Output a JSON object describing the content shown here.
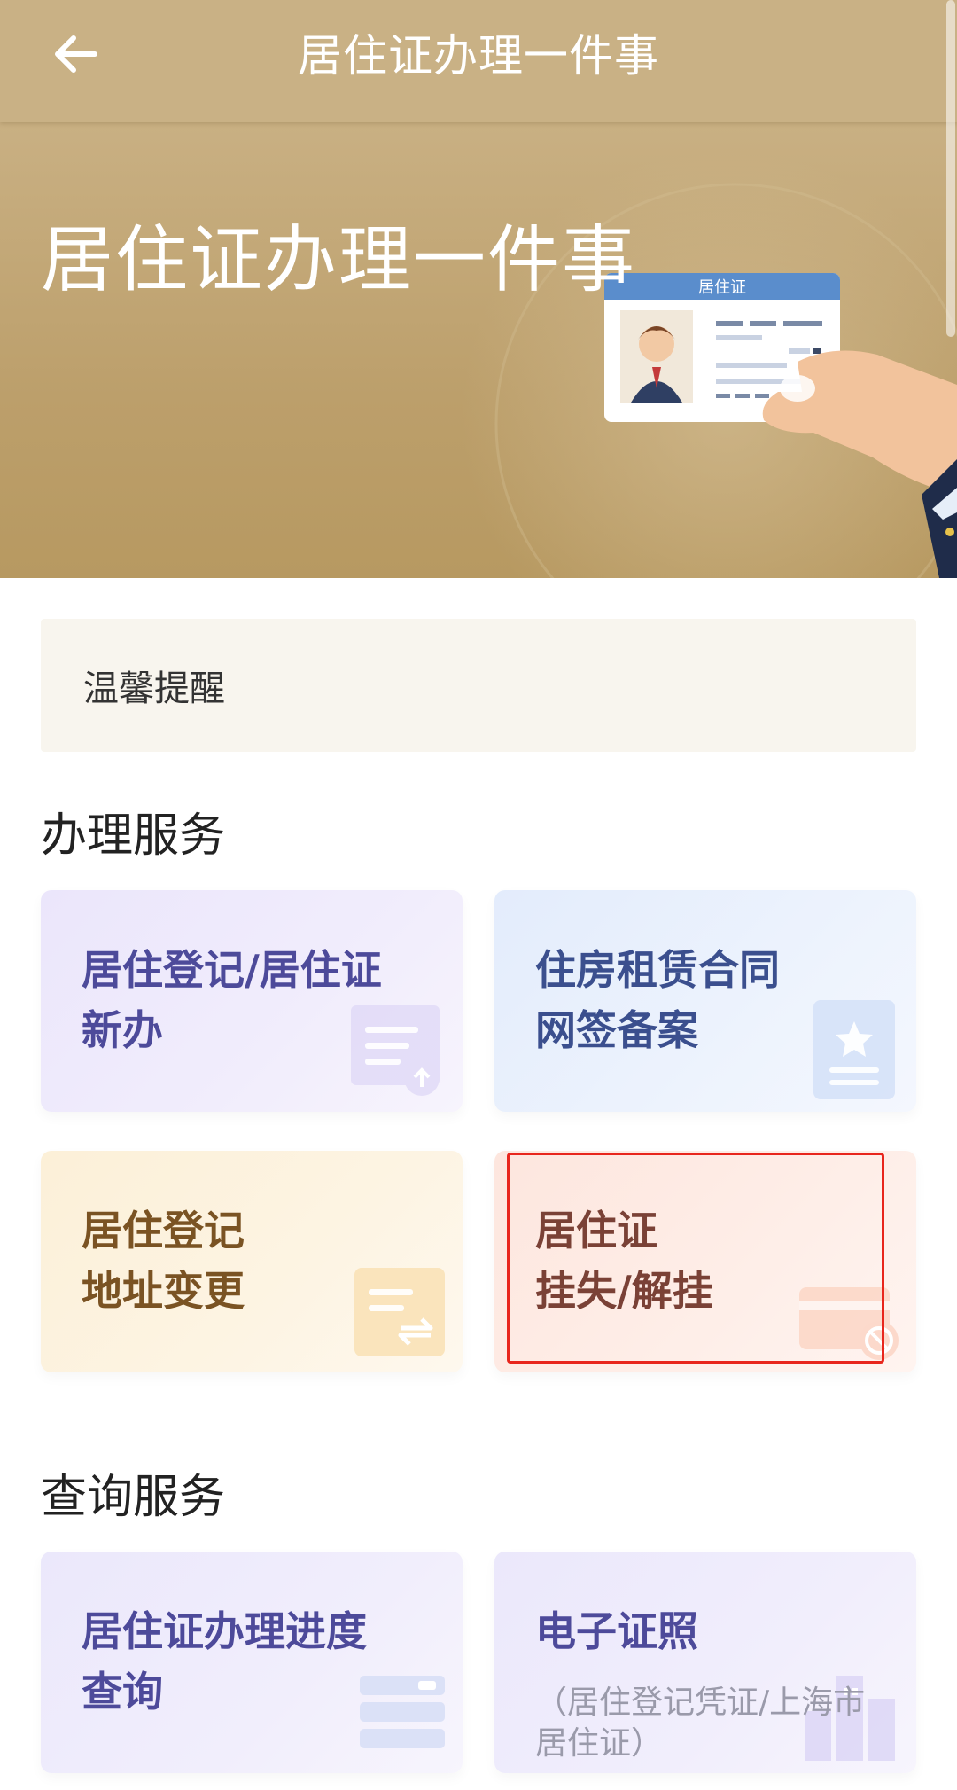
{
  "appbar": {
    "title": "居住证办理一件事",
    "back_icon": "arrow-left-icon"
  },
  "banner": {
    "title": "居住证办理一件事",
    "card_label": "居住证"
  },
  "reminder": {
    "label": "温馨提醒"
  },
  "sections": {
    "handle": {
      "title": "办理服务"
    },
    "query": {
      "title": "查询服务"
    }
  },
  "cards": {
    "residence_new": {
      "line1": "居住登记/居住证",
      "line2": "新办",
      "icon": "document-upload-icon"
    },
    "rental_contract": {
      "line1": "住房租赁合同",
      "line2": "网签备案",
      "icon": "certificate-star-icon"
    },
    "address_change": {
      "line1": "居住登记",
      "line2": "地址变更",
      "icon": "transfer-arrows-icon"
    },
    "loss_report": {
      "line1": "居住证",
      "line2": "挂失/解挂",
      "icon": "card-blocked-icon"
    },
    "progress_query": {
      "line1": "居住证办理进度",
      "line2": "查询",
      "icon": "list-icon"
    },
    "e_license": {
      "line1": "电子证照",
      "sub": "（居住登记凭证/上海市居住证）",
      "icon": "building-icon"
    }
  },
  "colors": {
    "highlight": "#e8261d",
    "banner": "#c9b185"
  }
}
